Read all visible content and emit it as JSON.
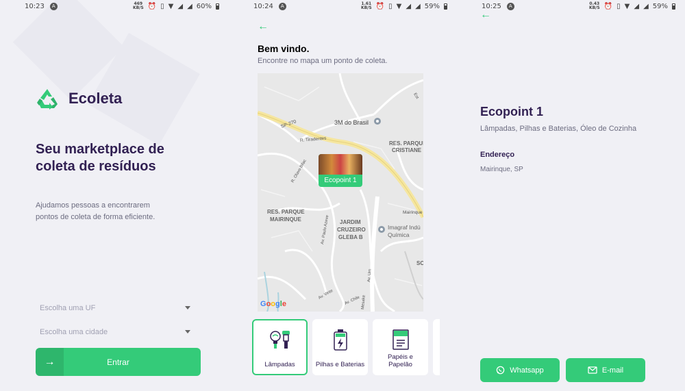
{
  "screens": [
    {
      "status": {
        "time": "10:23",
        "speed_top": "469",
        "speed_bottom": "KB/S",
        "battery": "60%"
      }
    },
    {
      "status": {
        "time": "10:24",
        "speed_top": "1.61",
        "speed_bottom": "KB/S",
        "battery": "59%"
      }
    },
    {
      "status": {
        "time": "10:25",
        "speed_top": "0.43",
        "speed_bottom": "KB/S",
        "battery": "59%"
      }
    }
  ],
  "home": {
    "logo_text": "Ecoleta",
    "title": "Seu marketplace de coleta de resíduos",
    "description": "Ajudamos pessoas a encontrarem pontos de coleta de forma eficiente.",
    "uf_placeholder": "Escolha uma UF",
    "city_placeholder": "Escolha uma cidade",
    "enter_label": "Entrar",
    "enter_icon": "arrow-right-icon"
  },
  "points": {
    "back_icon": "arrow-left-icon",
    "title": "Bem vindo.",
    "subtitle": "Encontre no mapa um ponto de coleta.",
    "map": {
      "labels": {
        "sp270": "SP-270",
        "tiradentes": "R. Tiradentes",
        "olavo_bilac": "R. Olavo Bilac",
        "brasil_3m": "3M do Brasil",
        "res_parque_cristiane": [
          "RES. PARQUE",
          "CRISTIANE"
        ],
        "res_parque_mairinque": [
          "RES. PARQUE",
          "MAIRINQUE"
        ],
        "jardim_cruzeiro": [
          "JARDIM",
          "CRUZEIRO",
          "GLEBA B"
        ],
        "imagraf": [
          "Imagraf Indú",
          "Química"
        ],
        "mairinque": "Mairinque",
        "est": "Est",
        "sc": "SC",
        "paulo_azeve": "Av. Paulo Azeve",
        "av_um": "Av. Um",
        "av_vinte": "Av. Vinte",
        "av_chile": "Av. Chile",
        "mesake": "Mesake"
      },
      "marker_label": "Ecopoint 1",
      "google": [
        "G",
        "o",
        "o",
        "g",
        "l",
        "e"
      ],
      "google_colors": [
        "#4285f4",
        "#ea4335",
        "#fbbc05",
        "#4285f4",
        "#34a853",
        "#ea4335"
      ]
    },
    "items": [
      {
        "label": "Lâmpadas",
        "icon": "lightbulb-icon",
        "selected": true
      },
      {
        "label": "Pilhas e Baterias",
        "icon": "battery-icon",
        "selected": false
      },
      {
        "label": "Papéis e Papelão",
        "icon": "paper-icon",
        "selected": false
      }
    ]
  },
  "detail": {
    "back_icon": "arrow-left-icon",
    "name": "Ecopoint 1",
    "items": "Lâmpadas, Pilhas e Baterias, Óleo de Cozinha",
    "address_title": "Endereço",
    "address": "Mairinque, SP",
    "whatsapp_label": "Whatsapp",
    "email_label": "E-mail"
  },
  "colors": {
    "primary": "#34cb79",
    "title": "#322153",
    "text": "#6c6c80",
    "background": "#f0f0f5"
  }
}
